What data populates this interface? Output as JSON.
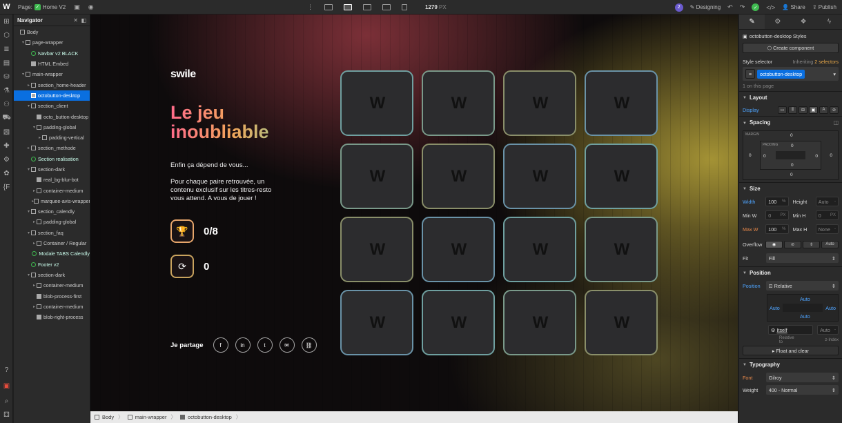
{
  "topbar": {
    "page_prefix": "Page:",
    "page_name": "Home V2",
    "width_value": "1279",
    "width_unit": "PX",
    "collab_count": "2",
    "mode": "Designing",
    "share": "Share",
    "publish": "Publish"
  },
  "navigator": {
    "title": "Navigator",
    "items": [
      {
        "label": "Body",
        "indent": 0,
        "caret": false,
        "kind": "box",
        "selected": false
      },
      {
        "label": "page-wrapper",
        "indent": 1,
        "caret": true,
        "kind": "box",
        "selected": false
      },
      {
        "label": "Navbar v2 BLACK",
        "indent": 2,
        "caret": false,
        "kind": "comp",
        "selected": false
      },
      {
        "label": "HTML Embed",
        "indent": 2,
        "caret": false,
        "kind": "embed",
        "selected": false
      },
      {
        "label": "main-wrapper",
        "indent": 1,
        "caret": true,
        "kind": "box",
        "selected": false
      },
      {
        "label": "section_home-header",
        "indent": 2,
        "caret": true,
        "kind": "box",
        "selected": false
      },
      {
        "label": "octobutton-desktop",
        "indent": 2,
        "caret": false,
        "kind": "embed",
        "selected": true
      },
      {
        "label": "section_client",
        "indent": 2,
        "caret": true,
        "kind": "box",
        "selected": false
      },
      {
        "label": "octo_button-desktop",
        "indent": 3,
        "caret": false,
        "kind": "embed",
        "selected": false
      },
      {
        "label": "padding-global",
        "indent": 3,
        "caret": true,
        "kind": "box",
        "selected": false
      },
      {
        "label": "padding-vertical",
        "indent": 4,
        "caret": true,
        "kind": "box",
        "selected": false
      },
      {
        "label": "section_methode",
        "indent": 2,
        "caret": true,
        "kind": "box",
        "selected": false
      },
      {
        "label": "Section realisation",
        "indent": 2,
        "caret": false,
        "kind": "comp",
        "selected": false
      },
      {
        "label": "section-dark",
        "indent": 2,
        "caret": true,
        "kind": "box",
        "selected": false
      },
      {
        "label": "real_bg-blur-bot",
        "indent": 3,
        "caret": false,
        "kind": "embed",
        "selected": false
      },
      {
        "label": "container-medium",
        "indent": 3,
        "caret": true,
        "kind": "box",
        "selected": false
      },
      {
        "label": "marquee-avis-wrapper",
        "indent": 3,
        "caret": true,
        "kind": "box",
        "selected": false
      },
      {
        "label": "section_calendly",
        "indent": 2,
        "caret": true,
        "kind": "box",
        "selected": false
      },
      {
        "label": "padding-global",
        "indent": 3,
        "caret": true,
        "kind": "box",
        "selected": false
      },
      {
        "label": "section_faq",
        "indent": 2,
        "caret": true,
        "kind": "box",
        "selected": false
      },
      {
        "label": "Container / Regular",
        "indent": 3,
        "caret": true,
        "kind": "box",
        "selected": false
      },
      {
        "label": "Modale TABS Calendly",
        "indent": 3,
        "caret": false,
        "kind": "comp",
        "selected": false
      },
      {
        "label": "Footer v2",
        "indent": 2,
        "caret": false,
        "kind": "comp",
        "selected": false
      },
      {
        "label": "section-dark",
        "indent": 2,
        "caret": true,
        "kind": "box",
        "selected": false
      },
      {
        "label": "container-medium",
        "indent": 3,
        "caret": true,
        "kind": "box",
        "selected": false
      },
      {
        "label": "blob-process-first",
        "indent": 3,
        "caret": false,
        "kind": "embed",
        "selected": false
      },
      {
        "label": "container-medium",
        "indent": 3,
        "caret": true,
        "kind": "box",
        "selected": false
      },
      {
        "label": "blob-right-process",
        "indent": 3,
        "caret": false,
        "kind": "embed",
        "selected": false
      }
    ]
  },
  "canvas": {
    "brand": "swile",
    "headline_1": "Le jeu",
    "headline_2": "inoubliable",
    "subtitle": "Enfin ça dépend de vous...",
    "desc_1": "Pour chaque paire retrouvée, un",
    "desc_2": "contenu exclusif sur les titres-resto",
    "desc_3": "vous attend. A vous de jouer !",
    "score": "0/8",
    "moves": "0",
    "share_label": "Je partage",
    "share_buttons": [
      "f",
      "in",
      "t",
      "✉",
      "⛓"
    ],
    "card_glyph": "W",
    "card_count": 16
  },
  "breadcrumb": {
    "items": [
      "Body",
      "main-wrapper",
      "octobutton-desktop"
    ]
  },
  "panel": {
    "styles_title": "octobutton-desktop Styles",
    "create_component": "Create component",
    "style_selector": "Style selector",
    "inheriting": "Inheriting",
    "inheriting_count": "2 selectors",
    "selector_name": "octobutton-desktop",
    "on_page": "1 on this page",
    "layout": "Layout",
    "display": "Display",
    "spacing": "Spacing",
    "margin_label": "MARGIN",
    "padding_label": "PADDING",
    "zero": "0",
    "size": "Size",
    "width": "Width",
    "width_value": "100",
    "width_unit": "%",
    "height": "Height",
    "auto": "Auto",
    "min_w": "Min W",
    "min_h": "Min H",
    "px": "PX",
    "max_w": "Max W",
    "max_w_value": "100",
    "max_h": "Max H",
    "none": "None",
    "overflow": "Overflow",
    "fit": "Fit",
    "fit_value": "Fill",
    "position": "Position",
    "position_value": "Relative",
    "itself": "Itself",
    "relative_to": "Relative to",
    "z_index": "z-Index",
    "float_clear": "Float and clear",
    "typography": "Typography",
    "font": "Font",
    "font_value": "Gilroy",
    "weight": "Weight",
    "weight_value": "400 - Normal"
  },
  "colors": {
    "accent": "#0a6fe0",
    "success": "#3fb950",
    "label_blue": "#4ea4ff",
    "label_orange": "#e8884a"
  }
}
